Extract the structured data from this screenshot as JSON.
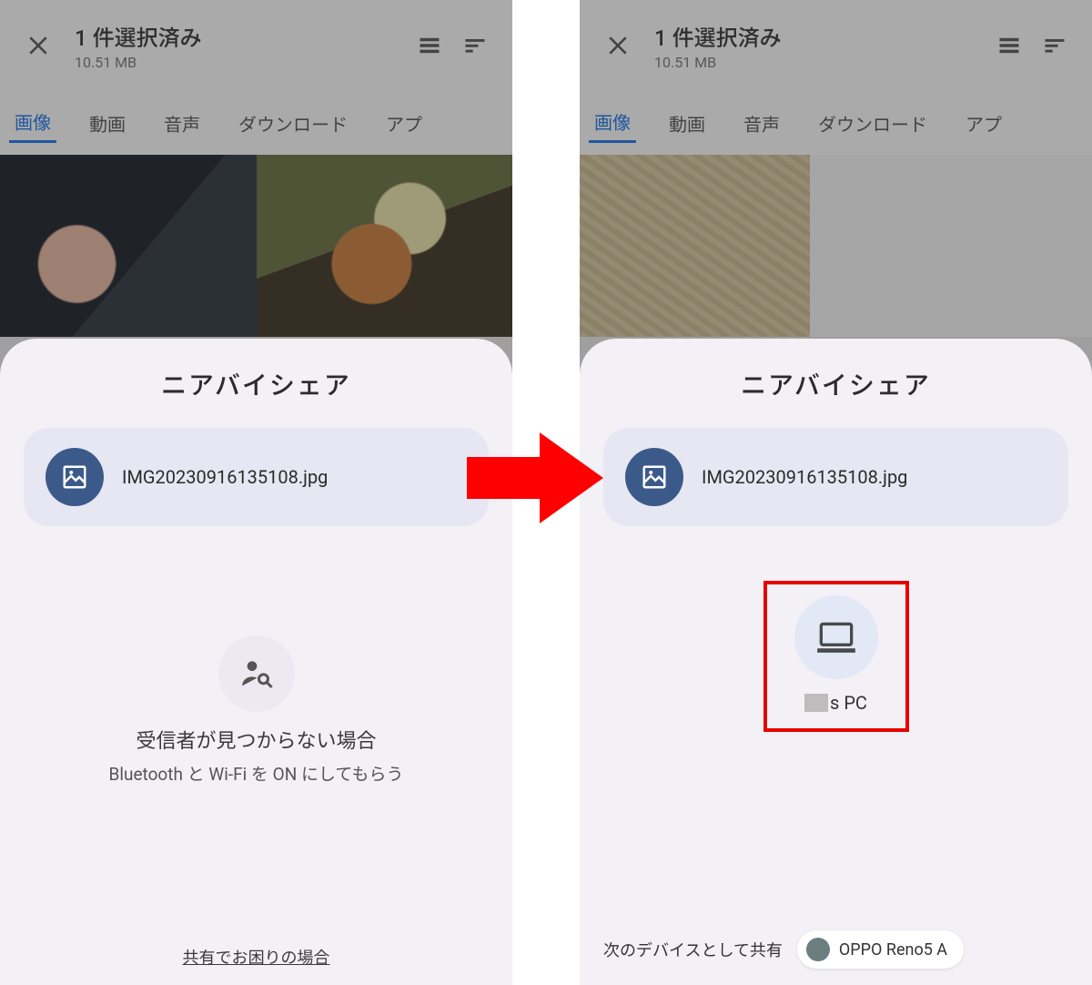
{
  "header": {
    "title": "1 件選択済み",
    "subtitle": "10.51 MB"
  },
  "tabs": {
    "items": [
      "画像",
      "動画",
      "音声",
      "ダウンロード",
      "アプ"
    ],
    "active_index": 0
  },
  "sheet": {
    "title": "ニアバイシェア",
    "file": {
      "name": "IMG20230916135108.jpg"
    },
    "searching": {
      "line1": "受信者が見つからない場合",
      "line2": "Bluetooth と Wi-Fi を ON にしてもらう"
    },
    "help_link": "共有でお困りの場合",
    "device": {
      "name_suffix": "s PC"
    },
    "share_as_label": "次のデバイスとして共有",
    "share_as_device": "OPPO Reno5 A"
  }
}
